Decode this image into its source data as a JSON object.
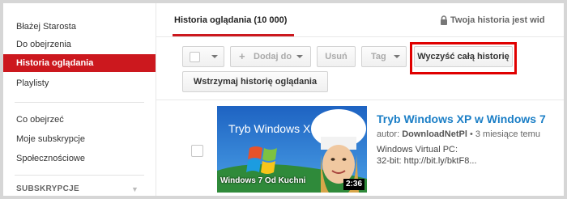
{
  "sidebar": {
    "items": [
      {
        "label": "Błażej Starosta"
      },
      {
        "label": "Do obejrzenia"
      },
      {
        "label": "Historia oglądania"
      },
      {
        "label": "Playlisty"
      },
      {
        "label": "Co obejrzeć"
      },
      {
        "label": "Moje subskrypcje"
      },
      {
        "label": "Społecznościowe"
      }
    ],
    "section_header": "SUBSKRYPCJE"
  },
  "header": {
    "tab_label": "Historia oglądania (10 000)",
    "privacy_text": "Twoja historia jest wid"
  },
  "toolbar": {
    "add_to_label": "Dodaj do",
    "remove_label": "Usuń",
    "tag_label": "Tag",
    "clear_all_label": "Wyczyść całą historię",
    "pause_label": "Wstrzymaj historię oglądania"
  },
  "video": {
    "title": "Tryb Windows XP w Windows 7",
    "author_prefix": "autor:",
    "author": "DownloadNetPl",
    "separator": "•",
    "age": "3 miesiące temu",
    "desc_line1": "Windows Virtual PC:",
    "desc_line2": "32-bit: http://bit.ly/bktF8...",
    "duration": "2:36",
    "thumb_title": "Tryb Windows XP",
    "thumb_caption": "Windows 7 Od Kuchni"
  },
  "colors": {
    "accent_red": "#cc181e",
    "link_blue": "#1a7ec6",
    "highlight_red": "#e00000"
  },
  "icons": {
    "lock": "lock-icon",
    "plus": "plus-icon",
    "chevron": "chevron-down-icon"
  }
}
